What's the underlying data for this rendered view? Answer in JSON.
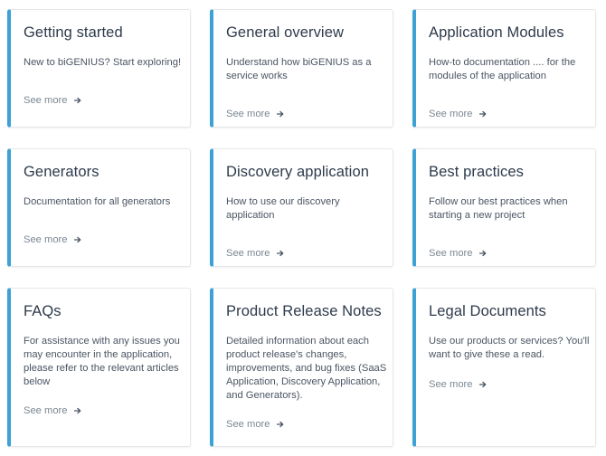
{
  "colors": {
    "accent": "#3ea1d6",
    "title": "#2d3a4b",
    "text": "#4a5563",
    "link": "#7b8793"
  },
  "cards": [
    {
      "title": "Getting started",
      "description": "New to biGENIUS? Start exploring!",
      "link": "See more",
      "icon": "arrow-right-icon"
    },
    {
      "title": "General overview",
      "description": "Understand how biGENIUS as a service works",
      "link": "See more",
      "icon": "arrow-right-icon"
    },
    {
      "title": "Application Modules",
      "description": "How-to documentation .... for the modules of the application",
      "link": "See more",
      "icon": "arrow-right-icon"
    },
    {
      "title": "Generators",
      "description": "Documentation for all generators",
      "link": "See more",
      "icon": "arrow-right-icon"
    },
    {
      "title": "Discovery application",
      "description": "How to use our discovery application",
      "link": "See more",
      "icon": "arrow-right-icon"
    },
    {
      "title": "Best practices",
      "description": "Follow our best practices when starting a new project",
      "link": "See more",
      "icon": "arrow-right-icon"
    },
    {
      "title": "FAQs",
      "description": "For assistance with any issues you may encounter in the application, please refer to the relevant articles below",
      "link": "See more",
      "icon": "arrow-right-icon"
    },
    {
      "title": "Product Release Notes",
      "description": "Detailed information about each product release's changes, improvements, and bug fixes (SaaS Application, Discovery Application, and Generators).",
      "link": "See more",
      "icon": "arrow-right-icon"
    },
    {
      "title": "Legal Documents",
      "description": "Use our products or services? You'll want to give these a read.",
      "link": "See more",
      "icon": "arrow-right-icon"
    }
  ]
}
